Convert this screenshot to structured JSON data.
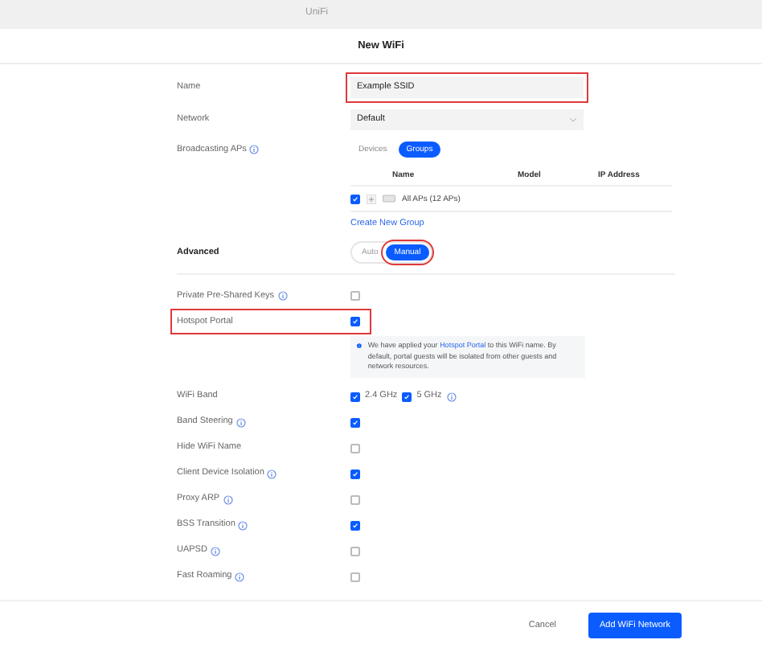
{
  "app_bar": {
    "title": "UniFi"
  },
  "dialog": {
    "title": "New WiFi"
  },
  "name_field": {
    "label": "Name",
    "value": "Example SSID",
    "highlighted": true
  },
  "network_field": {
    "label": "Network",
    "value": "Default"
  },
  "broadcasting_aps": {
    "label": "Broadcasting APs",
    "info": true,
    "tabs": [
      {
        "label": "Devices",
        "selected": false
      },
      {
        "label": "Groups",
        "selected": true
      }
    ],
    "columns": [
      "Name",
      "Model",
      "IP Address"
    ],
    "rows": [
      {
        "checked": true,
        "name": "All APs (12 APs)"
      }
    ],
    "link": "Create New Group"
  },
  "advanced": {
    "label": "Advanced",
    "modes": [
      {
        "label": "Auto",
        "selected": false,
        "highlighted": false
      },
      {
        "label": "Manual",
        "selected": true,
        "highlighted": true
      }
    ]
  },
  "options": [
    {
      "kind": "check",
      "label": "Private Pre-Shared Keys",
      "info": true,
      "checked": false,
      "highlighted": false
    },
    {
      "kind": "check",
      "label": "Hotspot Portal",
      "info": false,
      "checked": true,
      "highlighted": true,
      "notice": {
        "before": "We have applied your ",
        "link": "Hotspot Portal",
        "after": " to this WiFi name. By default, portal guests will be isolated from other guests and network resources."
      }
    },
    {
      "kind": "bands",
      "label": "WiFi Band",
      "info": false,
      "bands": [
        {
          "label": "2.4 GHz",
          "checked": true
        },
        {
          "label": "5 GHz",
          "checked": true
        }
      ],
      "bands_info": true
    },
    {
      "kind": "check",
      "label": "Band Steering",
      "info": true,
      "checked": true,
      "highlighted": false
    },
    {
      "kind": "check",
      "label": "Hide WiFi Name",
      "info": false,
      "checked": false,
      "highlighted": false
    },
    {
      "kind": "check",
      "label": "Client Device Isolation",
      "info": true,
      "checked": true,
      "highlighted": false
    },
    {
      "kind": "check",
      "label": "Proxy ARP",
      "info": true,
      "checked": false,
      "highlighted": false
    },
    {
      "kind": "check",
      "label": "BSS Transition",
      "info": true,
      "checked": true,
      "highlighted": false
    },
    {
      "kind": "check",
      "label": "UAPSD",
      "info": true,
      "checked": false,
      "highlighted": false
    },
    {
      "kind": "check",
      "label": "Fast Roaming",
      "info": true,
      "checked": false,
      "highlighted": false
    }
  ],
  "footer": {
    "cancel": "Cancel",
    "submit": "Add WiFi Network"
  }
}
